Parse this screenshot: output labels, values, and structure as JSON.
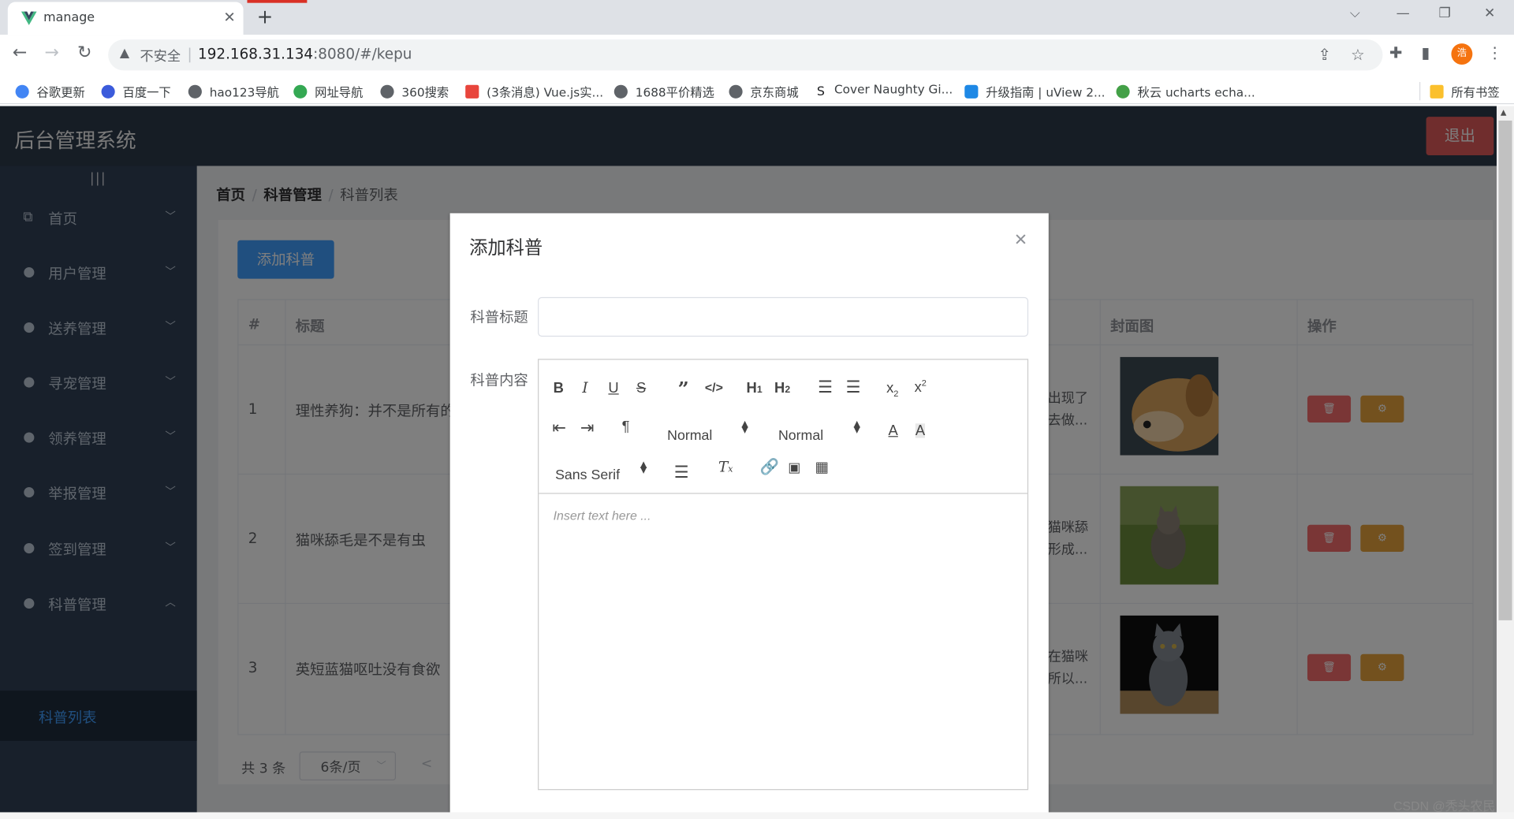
{
  "browser": {
    "tab_title": "manage",
    "tab_close": "✕",
    "new_tab": "+",
    "insecure_label": "不安全",
    "url_host": "192.168.31.134",
    "url_rest": ":8080/#/kepu",
    "avatar_text": "浩",
    "bookmarks": [
      {
        "label": "谷歌更新",
        "color": "#4285f4"
      },
      {
        "label": "百度一下",
        "color": "#3b5bdb"
      },
      {
        "label": "hao123导航",
        "color": "#5f6368"
      },
      {
        "label": "网址导航",
        "color": "#34a853"
      },
      {
        "label": "360搜索",
        "color": "#5f6368"
      },
      {
        "label": "(3条消息) Vue.js实...",
        "color": "#e8453c"
      },
      {
        "label": "1688平价精选",
        "color": "#5f6368"
      },
      {
        "label": "京东商城",
        "color": "#5f6368"
      },
      {
        "label": "Cover Naughty Gi...",
        "color": "#ffffff"
      },
      {
        "label": "升级指南 | uView 2...",
        "color": "#1e88e5"
      },
      {
        "label": "秋云 ucharts echa...",
        "color": "#43a047"
      }
    ],
    "all_bookmarks": "所有书签"
  },
  "app": {
    "brand": "后台管理系统",
    "logout": "退出",
    "collapse_icon": "|||",
    "menu": [
      {
        "label": "首页",
        "caret": "﹀"
      },
      {
        "label": "用户管理",
        "caret": "﹀"
      },
      {
        "label": "送养管理",
        "caret": "﹀"
      },
      {
        "label": "寻宠管理",
        "caret": "﹀"
      },
      {
        "label": "领养管理",
        "caret": "﹀"
      },
      {
        "label": "举报管理",
        "caret": "﹀"
      },
      {
        "label": "签到管理",
        "caret": "﹀"
      },
      {
        "label": "科普管理",
        "caret": "︿"
      }
    ],
    "submenu_active": "科普列表",
    "breadcrumb": [
      "首页",
      "科普管理",
      "科普列表"
    ],
    "breadcrumb_sep": "/",
    "add_button": "添加科普",
    "table": {
      "headers": {
        "num": "#",
        "title": "标题",
        "cover": "封面图",
        "ops": "操作"
      },
      "rows": [
        {
          "num": "1",
          "title": "理性养狗：并不是所有的",
          "content": "出现了去做..."
        },
        {
          "num": "2",
          "title": "猫咪舔毛是不是有虫",
          "content": "猫咪舔形成..."
        },
        {
          "num": "3",
          "title": "英短蓝猫呕吐没有食欲",
          "content": "在猫咪所以..."
        }
      ]
    },
    "pager": {
      "total": "共 3 条",
      "page_size": "6条/页",
      "prev": "<"
    }
  },
  "dialog": {
    "title": "添加科普",
    "close": "✕",
    "title_label": "科普标题",
    "title_value": "",
    "content_label": "科普内容",
    "editor": {
      "header_select": "Normal",
      "size_select": "Normal",
      "font_select": "Sans Serif",
      "placeholder": "Insert text here ..."
    }
  },
  "watermark": "CSDN @秃头农民"
}
